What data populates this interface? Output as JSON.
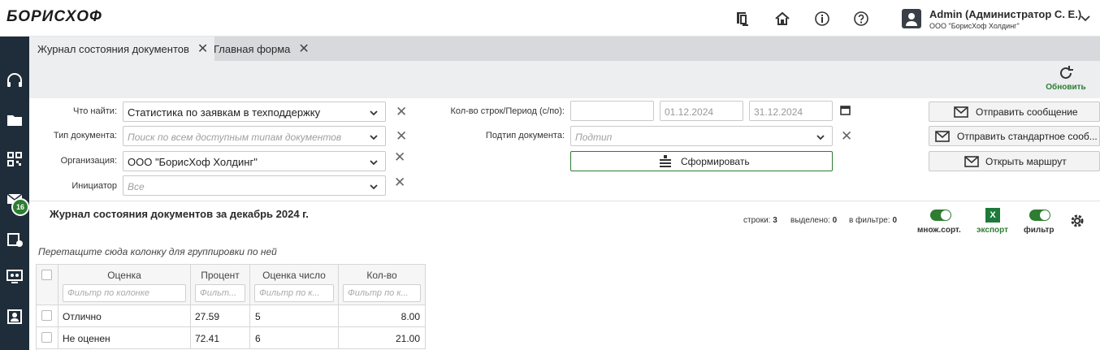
{
  "app": {
    "logo": "БОРИСХОФ",
    "user_name": "Admin (Администратор С. Е.)",
    "user_org": "ООО \"БорисХоф Холдинг\""
  },
  "sidebar": {
    "mail_badge": "16"
  },
  "tabs": [
    {
      "label": "Журнал состояния документов",
      "active": true
    },
    {
      "label": "Главная форма",
      "active": false
    }
  ],
  "toolbar": {
    "refresh_label": "Обновить"
  },
  "form": {
    "what_find_label": "Что найти:",
    "what_find_value": "Статистика по заявкам в техподдержку",
    "doc_type_label": "Тип документа:",
    "doc_type_placeholder": "Поиск по всем доступным типам документов",
    "org_label": "Организация:",
    "org_value": "ООО \"БорисХоф Холдинг\"",
    "initiator_label": "Инициатор",
    "initiator_placeholder": "Все",
    "rows_period_label": "Кол-во строк/Период (с/по):",
    "rows_value": "",
    "date_from": "01.12.2024",
    "date_to": "31.12.2024",
    "subtype_label": "Подтип документа:",
    "subtype_placeholder": "Подтип",
    "generate_label": "Сформировать",
    "send_message_label": "Отправить сообщение",
    "send_standard_label": "Отправить стандартное сооб...",
    "open_route_label": "Открыть маршрут"
  },
  "journal": {
    "title": "Журнал состояния документов за декабрь 2024 г.",
    "rows_label": "строки:",
    "rows_count": "3",
    "selected_label": "выделено:",
    "selected_count": "0",
    "filtered_label": "в фильтре:",
    "filtered_count": "0",
    "multisort_label": "множ.сорт.",
    "export_label": "экспорт",
    "export_icon_text": "X",
    "filter_label": "фильтр",
    "group_hint": "Перетащите сюда колонку для группировки по ней"
  },
  "grid": {
    "columns": [
      "Оценка",
      "Процент",
      "Оценка число",
      "Кол-во"
    ],
    "filter_placeholders": [
      "Фильтр по колонке",
      "Фильт...",
      "Фильтр по к...",
      "Фильтр по к..."
    ],
    "rows": [
      [
        "Отлично",
        "27.59",
        "5",
        "8.00"
      ],
      [
        "Не оценен",
        "72.41",
        "6",
        "21.00"
      ]
    ]
  },
  "colors": {
    "accent": "#2e7d32",
    "sidebar": "#1f2d3a",
    "tabstrip": "#d7d9dc",
    "toolbar": "#eceef0"
  }
}
